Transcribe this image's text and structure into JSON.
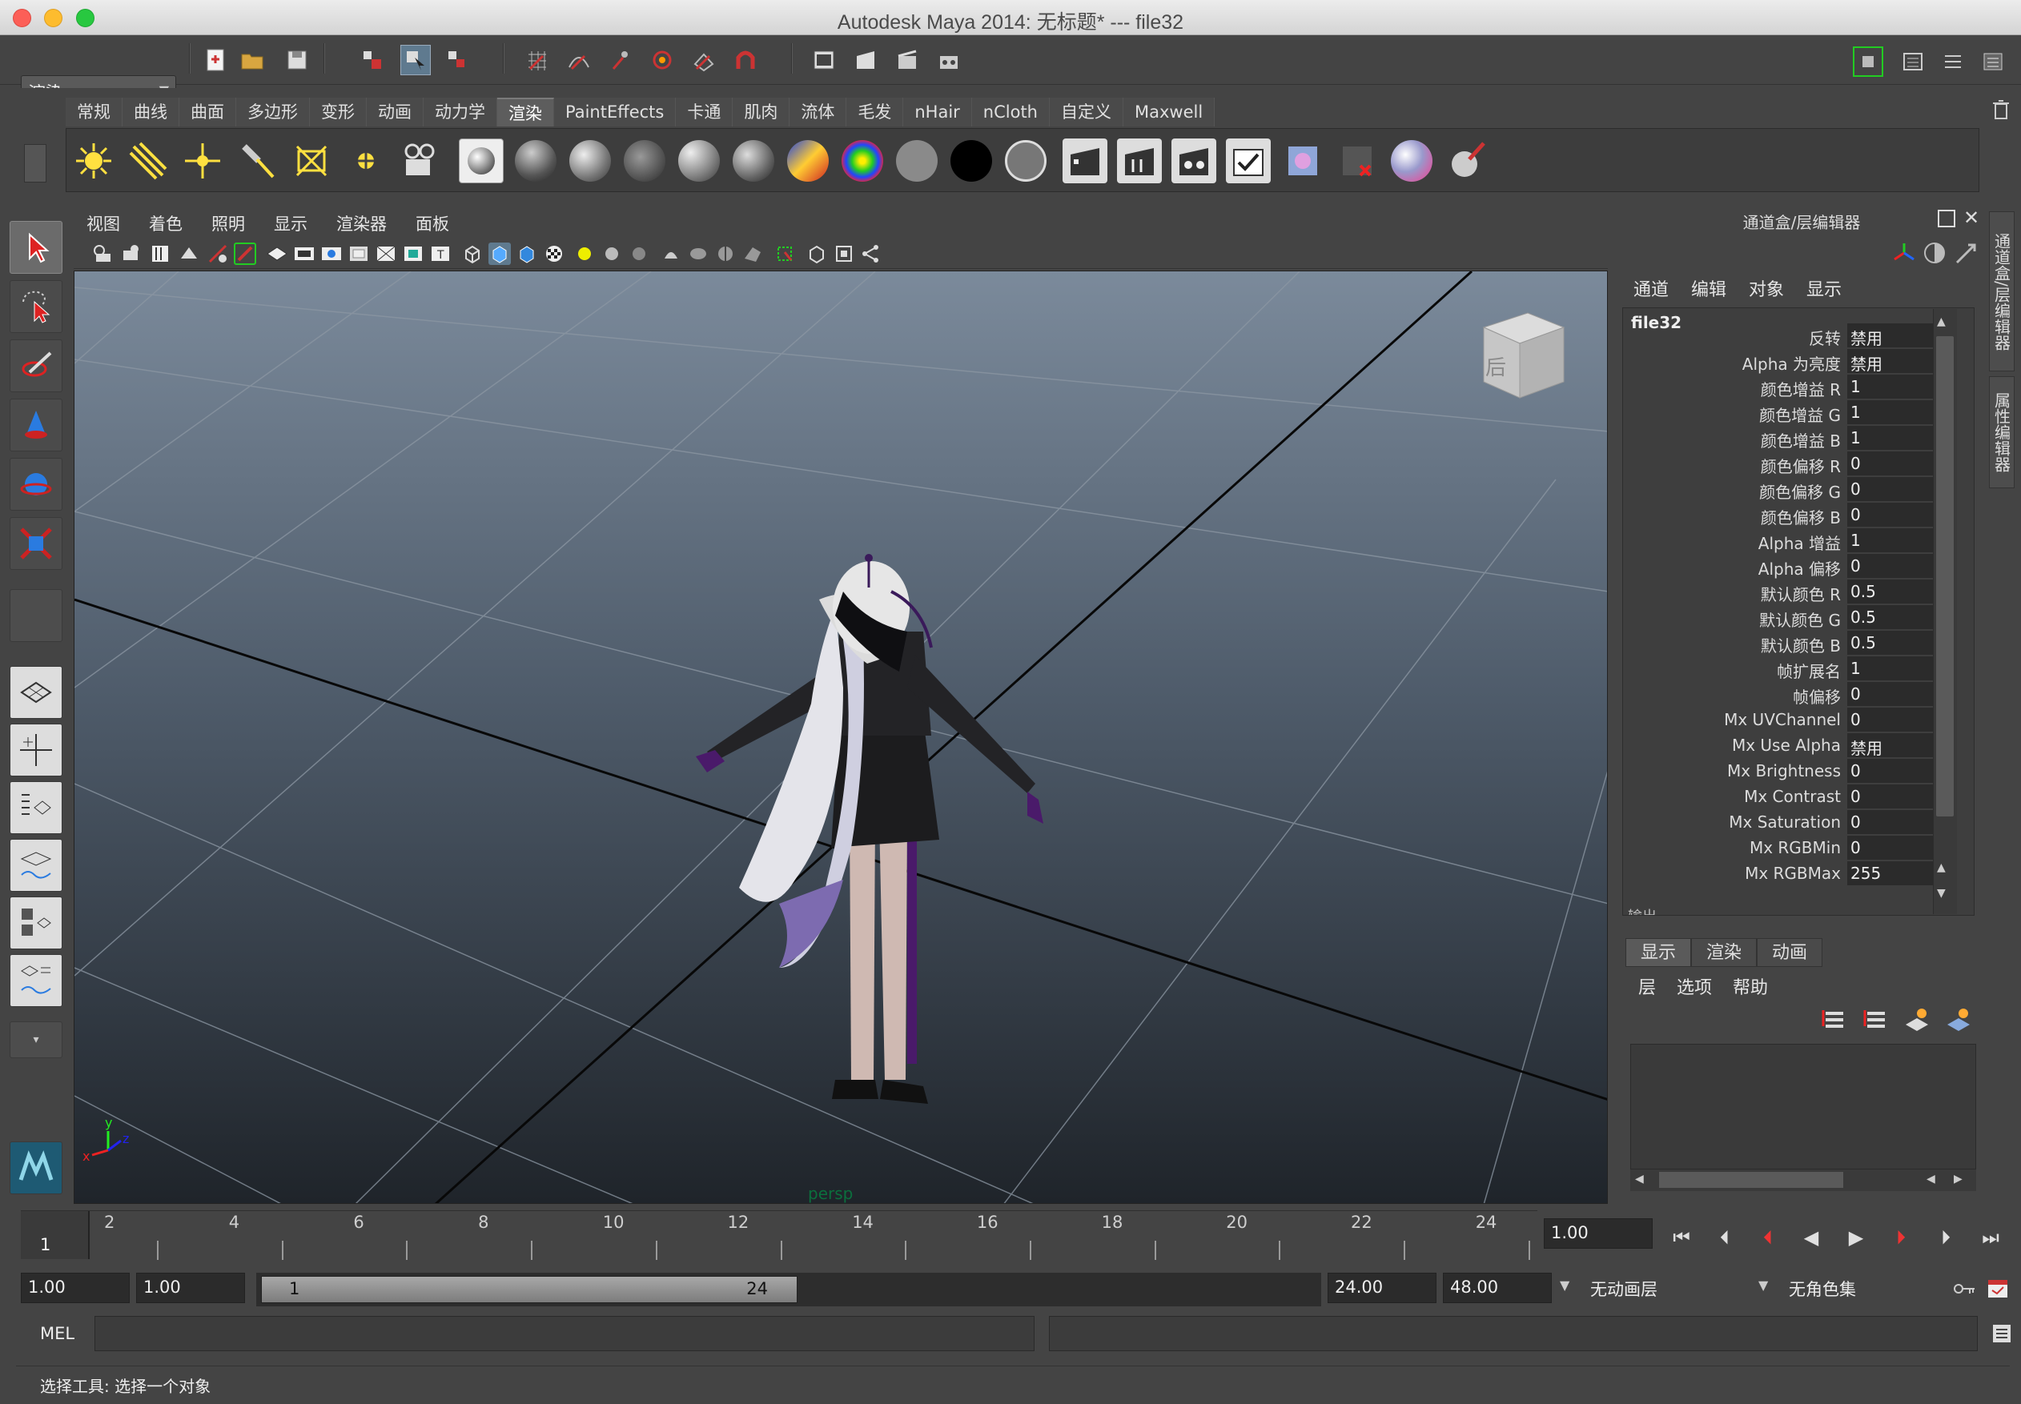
{
  "window": {
    "title": "Autodesk Maya 2014: 无标题*    ---    file32"
  },
  "status_line": {
    "mode_menu": "渲染"
  },
  "shelf": {
    "tabs": [
      "常规",
      "曲线",
      "曲面",
      "多边形",
      "变形",
      "动画",
      "动力学",
      "渲染",
      "PaintEffects",
      "卡通",
      "肌肉",
      "流体",
      "毛发",
      "nHair",
      "nCloth",
      "自定义",
      "Maxwell"
    ],
    "active_tab": "渲染"
  },
  "viewport": {
    "menus": [
      "视图",
      "着色",
      "照明",
      "显示",
      "渲染器",
      "面板"
    ],
    "camera_label": "persp",
    "viewcube_face": "后",
    "axis_x": "x",
    "axis_y": "y",
    "axis_z": "z"
  },
  "channel_box": {
    "panel_title": "通道盒/层编辑器",
    "menus": [
      "通道",
      "编辑",
      "对象",
      "显示"
    ],
    "node_name": "file32",
    "attributes": [
      {
        "label": "反转",
        "value": "禁用"
      },
      {
        "label": "Alpha 为亮度",
        "value": "禁用"
      },
      {
        "label": "颜色增益 R",
        "value": "1"
      },
      {
        "label": "颜色增益 G",
        "value": "1"
      },
      {
        "label": "颜色增益 B",
        "value": "1"
      },
      {
        "label": "颜色偏移 R",
        "value": "0"
      },
      {
        "label": "颜色偏移 G",
        "value": "0"
      },
      {
        "label": "颜色偏移 B",
        "value": "0"
      },
      {
        "label": "Alpha 增益",
        "value": "1"
      },
      {
        "label": "Alpha 偏移",
        "value": "0"
      },
      {
        "label": "默认颜色 R",
        "value": "0.5"
      },
      {
        "label": "默认颜色 G",
        "value": "0.5"
      },
      {
        "label": "默认颜色 B",
        "value": "0.5"
      },
      {
        "label": "帧扩展名",
        "value": "1"
      },
      {
        "label": "帧偏移",
        "value": "0"
      },
      {
        "label": "Mx UVChannel",
        "value": "0"
      },
      {
        "label": "Mx Use Alpha",
        "value": "禁用"
      },
      {
        "label": "Mx Brightness",
        "value": "0"
      },
      {
        "label": "Mx Contrast",
        "value": "0"
      },
      {
        "label": "Mx Saturation",
        "value": "0"
      },
      {
        "label": "Mx RGBMin",
        "value": "0"
      },
      {
        "label": "Mx RGBMax",
        "value": "255"
      }
    ],
    "cut_off_label": "输出"
  },
  "side_tabs": [
    "通道盒/层编辑器",
    "属性编辑器"
  ],
  "layer_editor": {
    "tabs": [
      "显示",
      "渲染",
      "动画"
    ],
    "active_tab": "显示",
    "menus": [
      "层",
      "选项",
      "帮助"
    ]
  },
  "time_slider": {
    "current_frame": "1",
    "tick_labels": [
      "2",
      "4",
      "6",
      "8",
      "10",
      "12",
      "14",
      "16",
      "18",
      "20",
      "22",
      "24"
    ],
    "current_time_field": "1.00"
  },
  "range_slider": {
    "start_time": "1.00",
    "playback_start": "1.00",
    "range_start_label": "1",
    "range_end_label": "24",
    "playback_end": "24.00",
    "end_time": "48.00",
    "anim_layer": "无动画层",
    "character_set": "无角色集"
  },
  "command_line": {
    "label": "MEL"
  },
  "help_line": {
    "text": "选择工具: 选择一个对象"
  },
  "colors": {
    "ui_bg": "#444444",
    "viewport_top": "#7b8a9b",
    "viewport_bottom": "#1f242a",
    "active_tab": "#5d5d5d",
    "field_bg": "#2b2b2b"
  }
}
